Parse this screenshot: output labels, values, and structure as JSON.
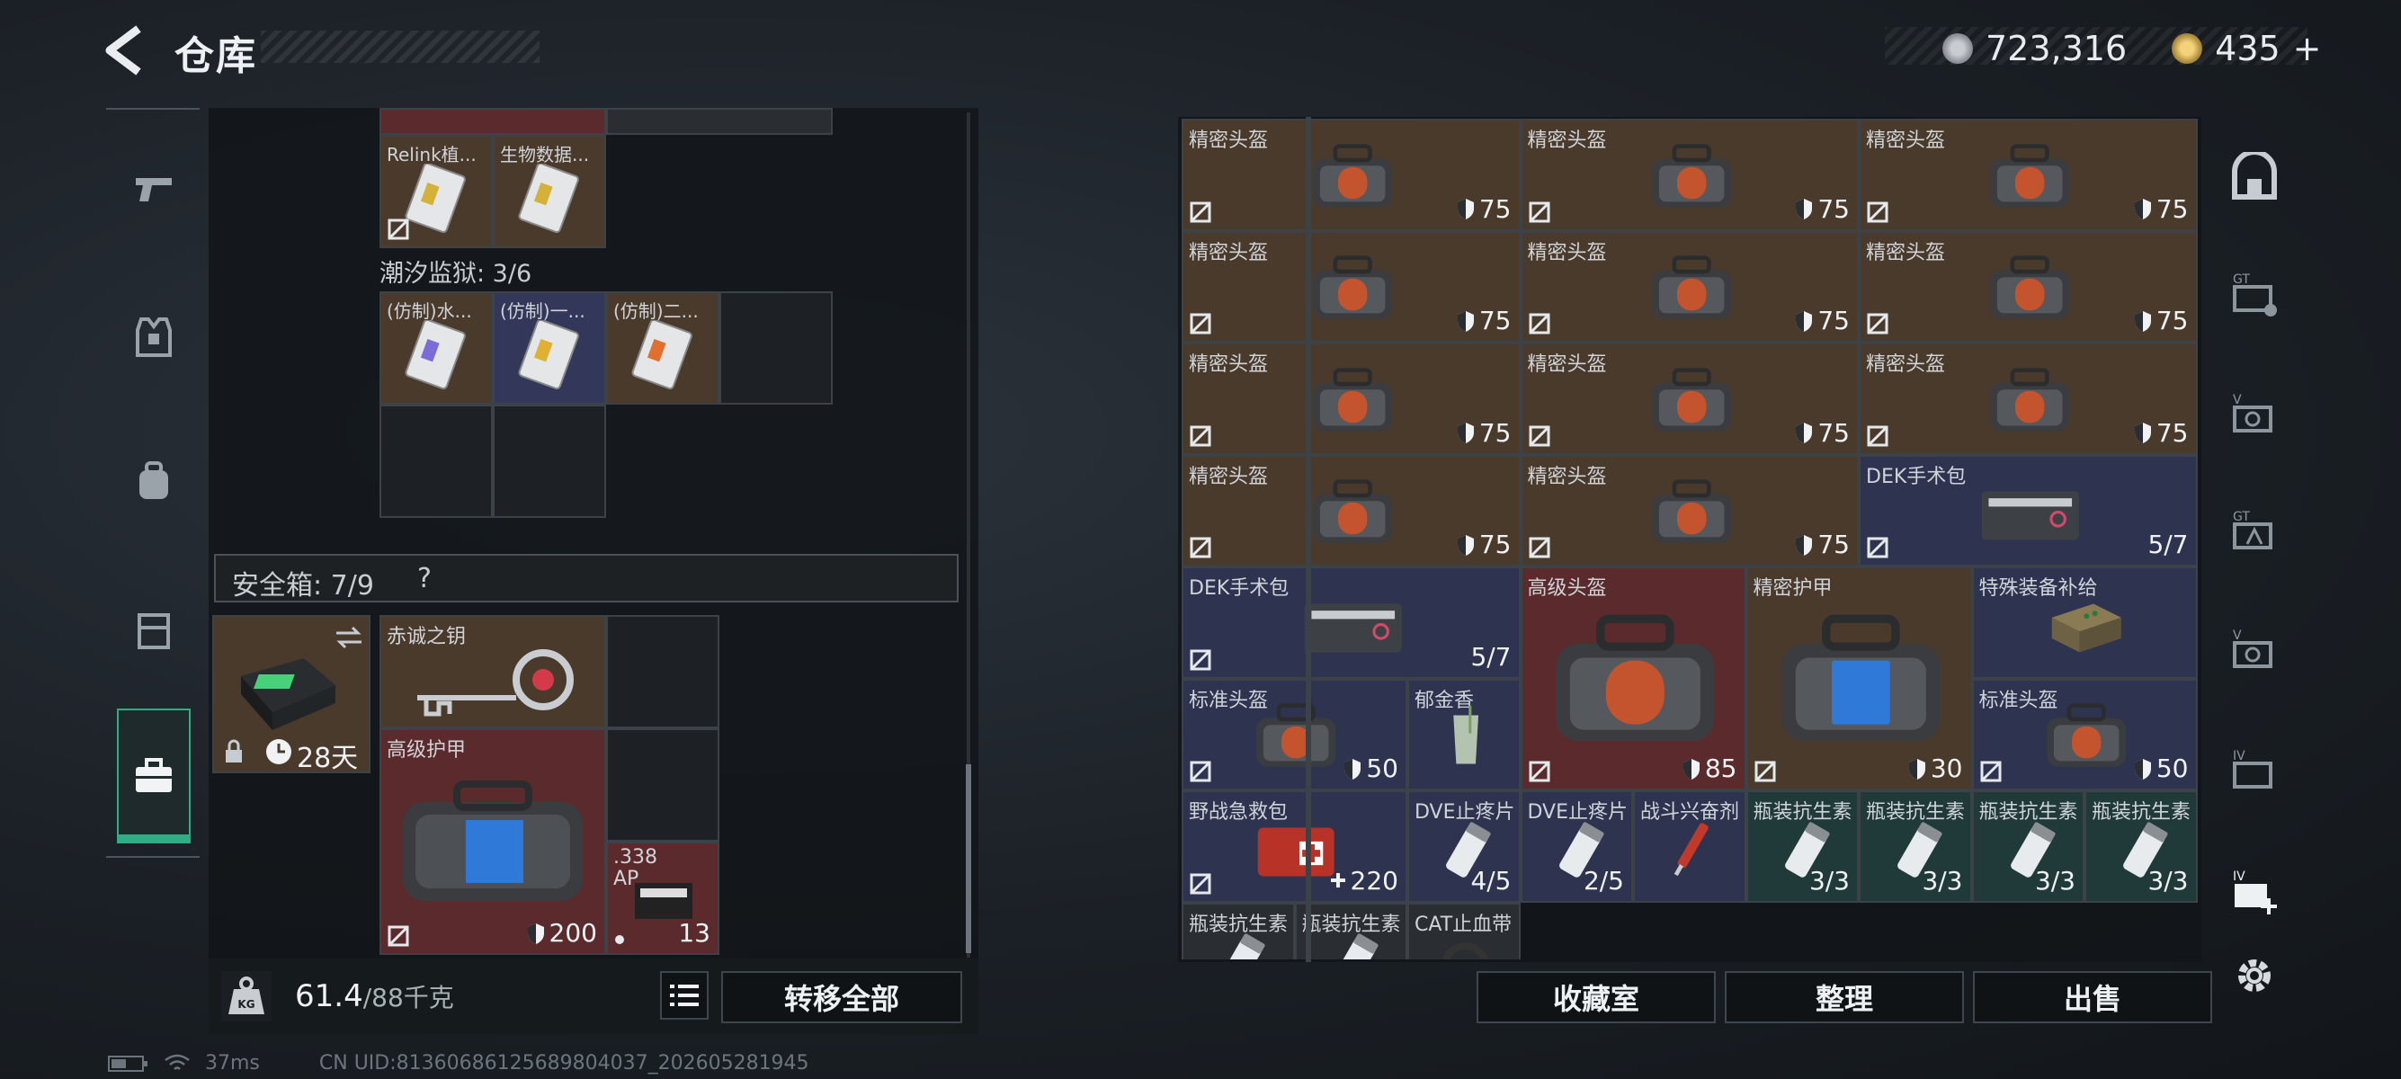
{
  "header": {
    "title": "仓库",
    "currency": [
      {
        "icon": "silver-coin-icon",
        "value": "723,316"
      },
      {
        "icon": "gold-coin-icon",
        "value": "435",
        "plus": "+"
      }
    ]
  },
  "left": {
    "top_items": [
      {
        "name": "Relink植...",
        "kind": "card-icon"
      },
      {
        "name": "生物数据...",
        "kind": "card-icon"
      }
    ],
    "section2_label": "潮汐监狱: 3/6",
    "section2_items": [
      {
        "name": "(仿制)水...",
        "kind": "card-icon"
      },
      {
        "name": "(仿制)一...",
        "kind": "card-icon"
      },
      {
        "name": "(仿制)二...",
        "kind": "card-icon"
      }
    ],
    "safe_label": "安全箱: 7/9",
    "safe_help": "?",
    "safe_case": {
      "timer": "28天"
    },
    "safe_items": [
      {
        "name": "赤诚之钥"
      },
      {
        "name": "高级护甲",
        "value": "200"
      },
      {
        "name": ".338 AP",
        "value": "13"
      }
    ],
    "weight": {
      "current": "61.4",
      "max": "/88千克"
    },
    "transfer_all": "转移全部"
  },
  "right": {
    "items": [
      {
        "name": "精密头盔",
        "value": "75",
        "bg": "brown"
      },
      {
        "name": "精密头盔",
        "value": "75",
        "bg": "brown"
      },
      {
        "name": "精密头盔",
        "value": "75",
        "bg": "brown"
      },
      {
        "name": "精密头盔",
        "value": "75",
        "bg": "brown"
      },
      {
        "name": "精密头盔",
        "value": "75",
        "bg": "brown"
      },
      {
        "name": "精密头盔",
        "value": "75",
        "bg": "brown"
      },
      {
        "name": "精密头盔",
        "value": "75",
        "bg": "brown"
      },
      {
        "name": "精密头盔",
        "value": "75",
        "bg": "brown"
      },
      {
        "name": "精密头盔",
        "value": "75",
        "bg": "brown"
      },
      {
        "name": "精密头盔",
        "value": "75",
        "bg": "brown"
      },
      {
        "name": "精密头盔",
        "value": "75",
        "bg": "brown"
      },
      {
        "name": "DEK手术包",
        "value": "5/7",
        "bg": "blue"
      },
      {
        "name": "DEK手术包",
        "value": "5/7",
        "bg": "blue"
      },
      {
        "name": "高级头盔",
        "value": "85",
        "bg": "red"
      },
      {
        "name": "精密护甲",
        "value": "30",
        "bg": "brown"
      },
      {
        "name": "特殊装备补给",
        "value": "",
        "bg": "blue"
      },
      {
        "name": "标准头盔",
        "value": "50",
        "bg": "blue"
      },
      {
        "name": "郁金香",
        "value": "",
        "bg": "blue"
      },
      {
        "name": "标准头盔",
        "value": "50",
        "bg": "blue"
      },
      {
        "name": "野战急救包",
        "value": "220",
        "bg": "blue"
      },
      {
        "name": "DVE止疼片",
        "value": "4/5",
        "bg": "blue"
      },
      {
        "name": "DVE止疼片",
        "value": "2/5",
        "bg": "blue"
      },
      {
        "name": "战斗兴奋剂",
        "value": "",
        "bg": "blue"
      },
      {
        "name": "瓶装抗生素",
        "value": "3/3",
        "bg": "green"
      },
      {
        "name": "瓶装抗生素",
        "value": "3/3",
        "bg": "green"
      },
      {
        "name": "瓶装抗生素",
        "value": "3/3",
        "bg": "green"
      },
      {
        "name": "瓶装抗生素",
        "value": "3/3",
        "bg": "green"
      },
      {
        "name": "瓶装抗生素",
        "value": "",
        "bg": "gray"
      },
      {
        "name": "瓶装抗生素",
        "value": "",
        "bg": "gray"
      },
      {
        "name": "CAT止血带",
        "value": "",
        "bg": "gray"
      }
    ],
    "buttons": {
      "collection": "收藏室",
      "organize": "整理",
      "sell": "出售"
    }
  },
  "status": {
    "ping": "37ms",
    "uid": "CN UID:8136068612568980403​7_202605281945"
  }
}
